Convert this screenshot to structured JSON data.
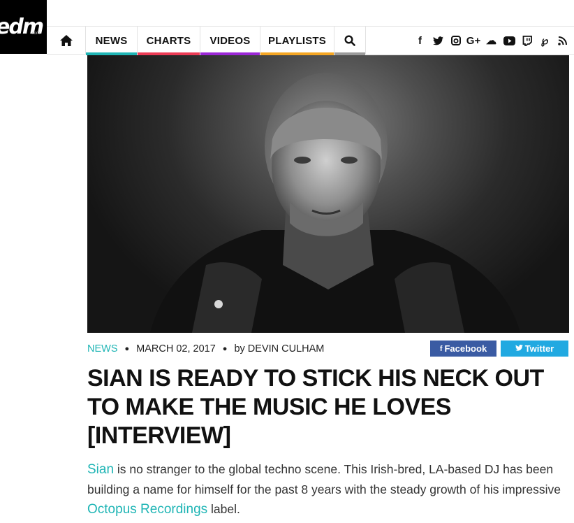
{
  "logo": {
    "text": "edm",
    "sub": ".com"
  },
  "nav": {
    "home_icon": "home-icon",
    "items": [
      {
        "label": "NEWS",
        "color": "#1fb5b5"
      },
      {
        "label": "CHARTS",
        "color": "#ec3b55"
      },
      {
        "label": "VIDEOS",
        "color": "#9b27d6"
      },
      {
        "label": "PLAYLISTS",
        "color": "#f5a623"
      }
    ],
    "search_icon": "search-icon",
    "search_color": "#9b9b9b",
    "social": [
      {
        "icon": "facebook-icon",
        "glyph": "f"
      },
      {
        "icon": "twitter-icon",
        "glyph": "🐦"
      },
      {
        "icon": "instagram-icon",
        "glyph": "◙"
      },
      {
        "icon": "google-plus-icon",
        "glyph": "G+"
      },
      {
        "icon": "soundcloud-icon",
        "glyph": "☁"
      },
      {
        "icon": "youtube-icon",
        "glyph": "▶"
      },
      {
        "icon": "twitch-icon",
        "glyph": "▣"
      },
      {
        "icon": "pinterest-icon",
        "glyph": "℘"
      },
      {
        "icon": "rss-icon",
        "glyph": "⋰"
      }
    ]
  },
  "article": {
    "category": "NEWS",
    "date": "MARCH 02, 2017",
    "byline": "by DEVIN CULHAM",
    "share_facebook": "Facebook",
    "share_twitter": "Twitter",
    "title": "SIAN IS READY TO STICK HIS NECK OUT TO MAKE THE MUSIC HE LOVES [INTERVIEW]",
    "lead": {
      "link1": "Sian",
      "text1": " is no stranger to the global techno scene. This Irish-bred, LA-based DJ has been building a name for himself for the past 8 years with the steady growth of his impressive ",
      "link2": "Octopus Recordings",
      "text2": " label."
    }
  },
  "colors": {
    "accent": "#1fb5b5",
    "facebook": "#3a5ba3",
    "twitter": "#21a9e1"
  }
}
